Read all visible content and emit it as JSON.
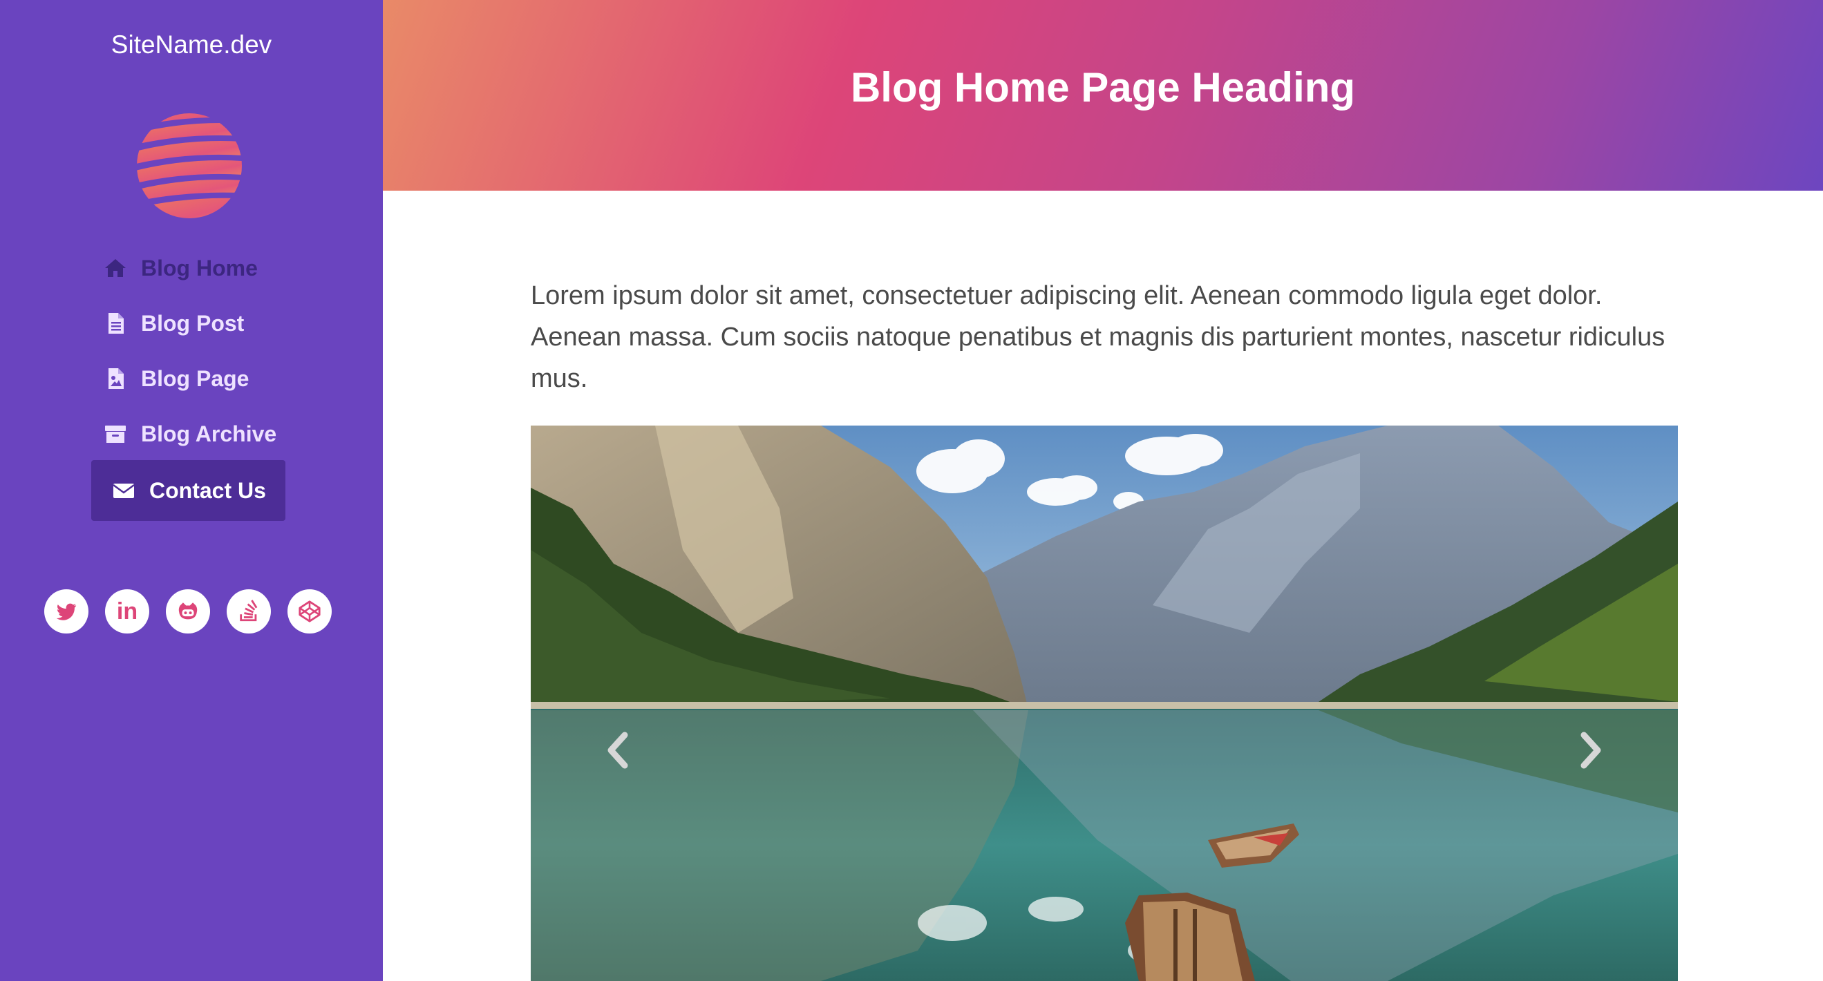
{
  "sidebar": {
    "site_name": "SiteName.dev",
    "logo_icon": "striped-globe-logo",
    "nav": [
      {
        "label": "Blog Home",
        "icon": "home-icon",
        "state": "current"
      },
      {
        "label": "Blog Post",
        "icon": "document-icon"
      },
      {
        "label": "Blog Page",
        "icon": "image-document-icon"
      },
      {
        "label": "Blog Archive",
        "icon": "archive-box-icon"
      },
      {
        "label": "Contact Us",
        "icon": "envelope-icon",
        "state": "active"
      }
    ],
    "social": [
      {
        "icon": "twitter-icon"
      },
      {
        "icon": "linkedin-icon",
        "text": "in"
      },
      {
        "icon": "github-icon"
      },
      {
        "icon": "stackoverflow-icon"
      },
      {
        "icon": "codepen-icon"
      }
    ]
  },
  "header": {
    "title": "Blog Home Page Heading"
  },
  "main": {
    "intro": "Lorem ipsum dolor sit amet, consectetuer adipiscing elit. Aenean commodo ligula eget dolor. Aenean massa. Cum sociis natoque penatibus et magnis dis parturient montes, nascetur ridiculus mus.",
    "carousel": {
      "image": "mountain-lake-with-rowboats-photo",
      "prev_icon": "chevron-left-icon",
      "next_icon": "chevron-right-icon"
    }
  },
  "colors": {
    "sidebar": "#6a44bf",
    "active_nav": "#4d2d97",
    "accent_pink": "#dd4578",
    "accent_orange": "#e98a68",
    "text": "#4a4a4a"
  }
}
